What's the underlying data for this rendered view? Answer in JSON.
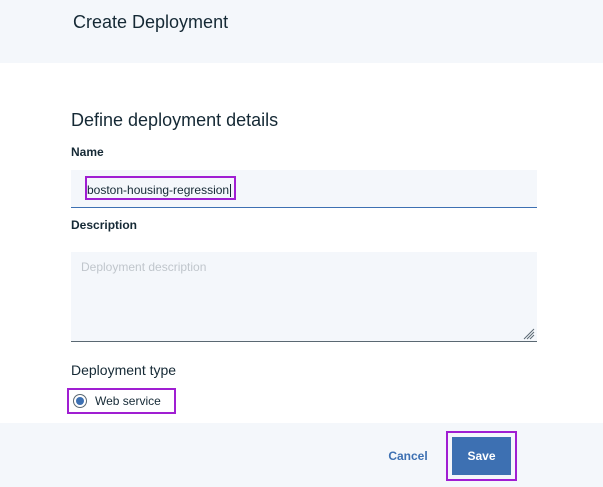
{
  "header": {
    "title": "Create Deployment"
  },
  "form": {
    "heading": "Define deployment details",
    "name": {
      "label": "Name",
      "value": "boston-housing-regression"
    },
    "description": {
      "label": "Description",
      "placeholder": "Deployment description",
      "value": ""
    },
    "deployment_type": {
      "label": "Deployment type",
      "options": [
        {
          "label": "Web service",
          "selected": true
        }
      ]
    }
  },
  "footer": {
    "cancel_label": "Cancel",
    "save_label": "Save"
  },
  "colors": {
    "accent": "#3d70b2",
    "header_bg": "#f4f7fb",
    "highlight": "#a01ed2",
    "text": "#152935"
  }
}
